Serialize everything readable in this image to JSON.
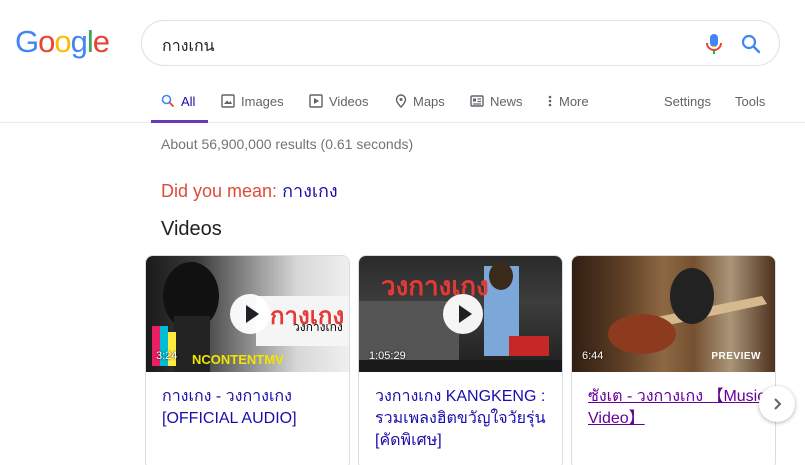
{
  "logo": {
    "letters": [
      "G",
      "o",
      "o",
      "g",
      "l",
      "e"
    ],
    "colors": [
      "#4285F4",
      "#EA4335",
      "#FBBC05",
      "#4285F4",
      "#34A853",
      "#EA4335"
    ]
  },
  "search": {
    "query": "กางเกน"
  },
  "tabs": [
    {
      "label": "All",
      "icon": "search-icon",
      "active": true
    },
    {
      "label": "Images",
      "icon": "image-icon"
    },
    {
      "label": "Videos",
      "icon": "video-icon"
    },
    {
      "label": "Maps",
      "icon": "map-pin-icon"
    },
    {
      "label": "News",
      "icon": "news-icon"
    },
    {
      "label": "More",
      "icon": "more-vert-icon"
    },
    {
      "label": "Settings"
    },
    {
      "label": "Tools"
    }
  ],
  "result_stats": "About 56,900,000 results (0.61 seconds)",
  "did_you_mean": {
    "prefix": "Did you mean: ",
    "suggestion": "กางเกง"
  },
  "videos_heading": "Videos",
  "videos": [
    {
      "duration": "3:24",
      "title": "กางเกง - วงกางเกง [OFFICIAL AUDIO]",
      "overlay_title": "กางเกง",
      "overlay_sub": "วงกางเกง",
      "overlay_brand": "NCONTENTMV"
    },
    {
      "duration": "1:05:29",
      "title": "วงกางเกง KANGKENG : รวมเพลงฮิตขวัญใจวัยรุ่น [คัดพิเศษ]",
      "overlay_title": "วงกางเกง"
    },
    {
      "duration": "6:44",
      "title": "ซังเต - วงกางเกง 【Music Video】",
      "badge": "PREVIEW"
    }
  ],
  "colors": {
    "accent": "#673ab7",
    "link": "#1a0dab",
    "visited": "#660099",
    "correction": "#dd4b39"
  }
}
